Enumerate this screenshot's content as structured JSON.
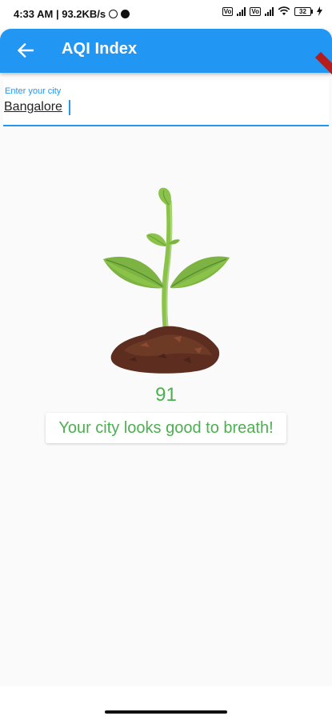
{
  "status_bar": {
    "left_text": "4:33 AM | 93.2KB/s",
    "sim1": "Vo",
    "sim2": "Vo",
    "battery": "32",
    "icons": [
      "whatsapp-icon",
      "data-saver-icon",
      "signal-icon",
      "wifi-icon",
      "battery-icon",
      "charging-icon"
    ]
  },
  "app_bar": {
    "title": "AQI Index",
    "back_icon": "arrow-left-icon",
    "color": "#2196f3"
  },
  "city_field": {
    "label": "Enter your city",
    "value": "Bangalore"
  },
  "result": {
    "aqi": "91",
    "message": "Your city looks good to breath!",
    "color": "#4caf50",
    "illustration": "sprout-icon"
  }
}
